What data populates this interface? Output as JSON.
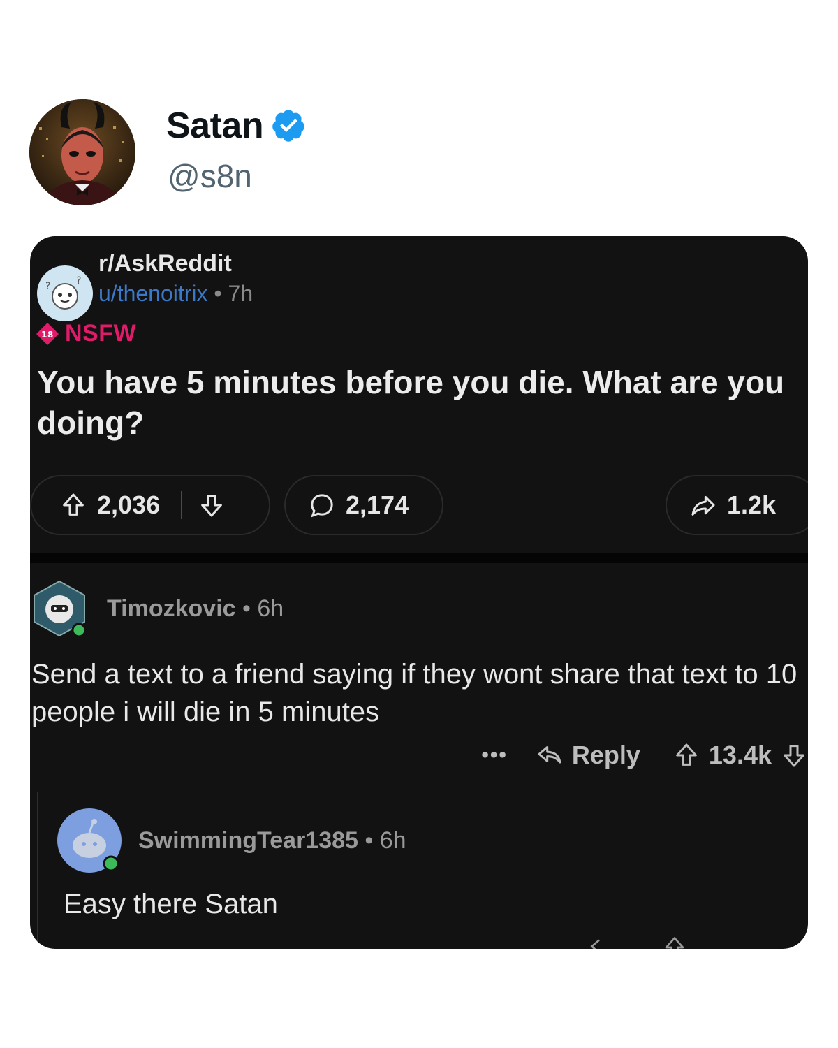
{
  "tweet": {
    "author_name": "Satan",
    "author_handle": "@s8n",
    "verified": true,
    "verified_color": "#1d9bf0"
  },
  "post": {
    "subreddit": "r/AskReddit",
    "user": "u/thenoitrix",
    "separator": "•",
    "time": "7h",
    "nsfw_badge": "18",
    "nsfw_label": "NSFW",
    "nsfw_color": "#e01b6a",
    "title": "You have 5 minutes before you die. What are you doing?",
    "upvotes": "2,036",
    "comments": "2,174",
    "shares": "1.2k"
  },
  "comment": {
    "author": "Timozkovic",
    "separator": "•",
    "time": "6h",
    "body": "Send a text to a friend saying if they wont share that text to 10 people i will die in 5 minutes",
    "more": "•••",
    "reply_label": "Reply",
    "upvotes": "13.4k"
  },
  "reply": {
    "author": "SwimmingTear1385",
    "separator": "•",
    "time": "6h",
    "body": "Easy there Satan"
  },
  "icons": [
    "verified-badge-icon",
    "upvote-icon",
    "downvote-icon",
    "comment-icon",
    "share-icon",
    "reply-icon",
    "more-icon",
    "nsfw-icon"
  ]
}
